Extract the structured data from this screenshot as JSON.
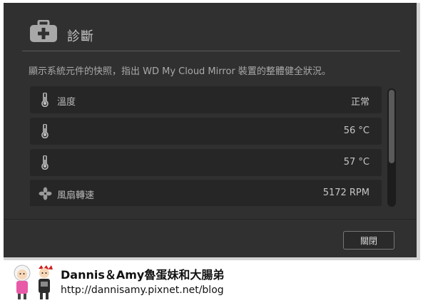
{
  "dialog": {
    "title": "診斷",
    "description": "顯示系統元件的快照，指出 WD My Cloud Mirror 裝置的整體健全狀況。",
    "rows": [
      {
        "icon": "thermometer-icon",
        "label": "溫度",
        "value": "正常"
      },
      {
        "icon": "thermometer-icon",
        "label": "",
        "value": "56 °C"
      },
      {
        "icon": "thermometer-icon",
        "label": "",
        "value": "57 °C"
      },
      {
        "icon": "fan-icon",
        "label": "風扇轉速",
        "value": "5172 RPM"
      }
    ],
    "close_label": "關閉"
  },
  "footer": {
    "brand": "Dannis＆Amy魯蛋妹和大腸弟",
    "url": "http://dannisamy.pixnet.net/blog"
  }
}
